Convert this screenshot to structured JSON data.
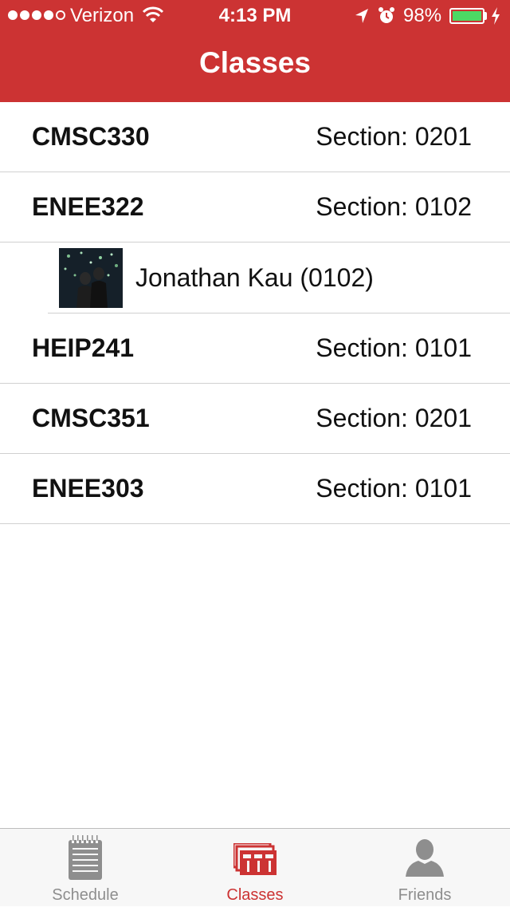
{
  "status_bar": {
    "carrier": "Verizon",
    "time": "4:13 PM",
    "battery_percent": "98%",
    "battery_level": 0.98,
    "signal_bars_filled": 4,
    "signal_bars_total": 5
  },
  "nav": {
    "title": "Classes"
  },
  "classes": [
    {
      "code": "CMSC330",
      "section": "Section: 0201"
    },
    {
      "code": "ENEE322",
      "section": "Section: 0102"
    },
    {
      "code": "HEIP241",
      "section": "Section: 0101"
    },
    {
      "code": "CMSC351",
      "section": "Section: 0201"
    },
    {
      "code": "ENEE303",
      "section": "Section: 0101"
    }
  ],
  "friend": {
    "name": "Jonathan Kau (0102)"
  },
  "tabs": [
    {
      "label": "Schedule",
      "icon": "notepad-icon",
      "active": false
    },
    {
      "label": "Classes",
      "icon": "classes-stack-icon",
      "active": true
    },
    {
      "label": "Friends",
      "icon": "person-icon",
      "active": false
    }
  ],
  "colors": {
    "brand": "#cc3333",
    "battery": "#4cd964",
    "tab_inactive": "#8e8e8e",
    "divider": "#d0d0d0"
  }
}
